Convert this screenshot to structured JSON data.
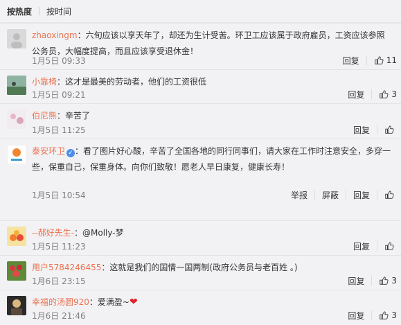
{
  "tabs": [
    {
      "label": "按热度",
      "active": true
    },
    {
      "label": "按时间",
      "active": false
    }
  ],
  "actions_labels": {
    "reply": "回复",
    "report": "举报",
    "block": "屏蔽"
  },
  "comments": [
    {
      "user": "zhaoxingm",
      "text": "：六旬应该以享天年了，却还为生计受苦。环卫工应该属于政府雇员，工资应该参照公务员，大幅度提高，而且应该享受退休金！",
      "time": "1月5日 09:33",
      "likes": "11"
    },
    {
      "user": "小靠椅",
      "text": "：这才是最美的劳动者，他们的工资很低",
      "time": "1月5日 09:21",
      "likes": "3"
    },
    {
      "user": "伯尼熊",
      "text": "：辛苦了",
      "time": "1月5日 11:25",
      "likes": ""
    },
    {
      "user": "泰安环卫",
      "text": "：看了图片好心酸，辛苦了全国各地的同行同事们，请大家在工作时注意安全，多穿一些，保重自己，保重身体。向你们致敬！愿老人早日康复，健康长寿！",
      "time": "1月5日 10:54",
      "likes": ""
    },
    {
      "user": "--郝好先生-",
      "text": "：@Molly-梦",
      "time": "1月5日 11:23",
      "likes": ""
    },
    {
      "user": "用户5784246455",
      "text": "：这就是我们的国情一国两制(政府公务员与老百姓 。)",
      "time": "1月6日 23:15",
      "likes": "3"
    },
    {
      "user": "幸福的汤圆920",
      "text": "：爱满盈~",
      "time": "1月6日 21:46",
      "likes": "3"
    }
  ],
  "colors": {
    "username": "#eb7350",
    "background": "#f2f2f5",
    "heart": "#e0252b",
    "vip_badge": "#4c8ee8"
  },
  "icons": {
    "like": "thumbs-up-icon",
    "verified": "verified-badge-icon",
    "heart": "heart-emoji-icon"
  }
}
